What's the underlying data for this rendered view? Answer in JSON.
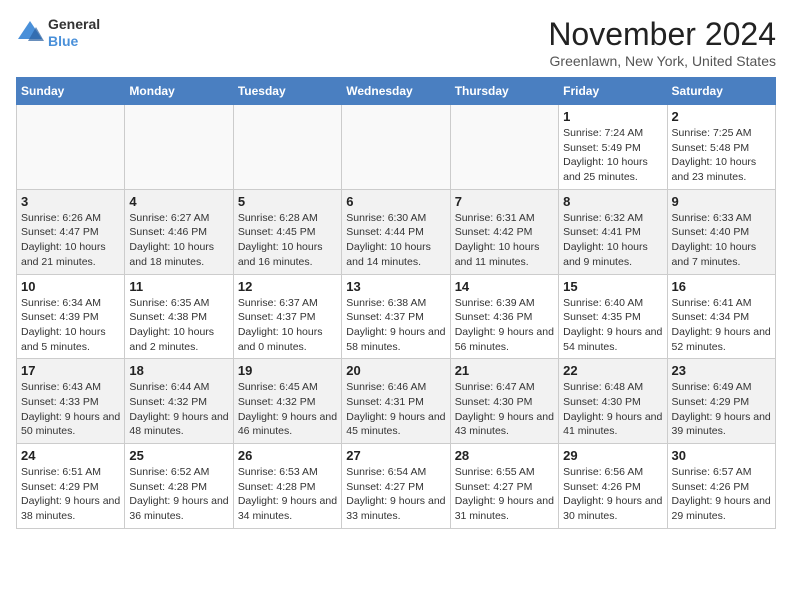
{
  "logo": {
    "general": "General",
    "blue": "Blue"
  },
  "header": {
    "month": "November 2024",
    "location": "Greenlawn, New York, United States"
  },
  "days_of_week": [
    "Sunday",
    "Monday",
    "Tuesday",
    "Wednesday",
    "Thursday",
    "Friday",
    "Saturday"
  ],
  "weeks": [
    {
      "alt": false,
      "days": [
        {
          "num": "",
          "info": ""
        },
        {
          "num": "",
          "info": ""
        },
        {
          "num": "",
          "info": ""
        },
        {
          "num": "",
          "info": ""
        },
        {
          "num": "",
          "info": ""
        },
        {
          "num": "1",
          "info": "Sunrise: 7:24 AM\nSunset: 5:49 PM\nDaylight: 10 hours and 25 minutes."
        },
        {
          "num": "2",
          "info": "Sunrise: 7:25 AM\nSunset: 5:48 PM\nDaylight: 10 hours and 23 minutes."
        }
      ]
    },
    {
      "alt": true,
      "days": [
        {
          "num": "3",
          "info": "Sunrise: 6:26 AM\nSunset: 4:47 PM\nDaylight: 10 hours and 21 minutes."
        },
        {
          "num": "4",
          "info": "Sunrise: 6:27 AM\nSunset: 4:46 PM\nDaylight: 10 hours and 18 minutes."
        },
        {
          "num": "5",
          "info": "Sunrise: 6:28 AM\nSunset: 4:45 PM\nDaylight: 10 hours and 16 minutes."
        },
        {
          "num": "6",
          "info": "Sunrise: 6:30 AM\nSunset: 4:44 PM\nDaylight: 10 hours and 14 minutes."
        },
        {
          "num": "7",
          "info": "Sunrise: 6:31 AM\nSunset: 4:42 PM\nDaylight: 10 hours and 11 minutes."
        },
        {
          "num": "8",
          "info": "Sunrise: 6:32 AM\nSunset: 4:41 PM\nDaylight: 10 hours and 9 minutes."
        },
        {
          "num": "9",
          "info": "Sunrise: 6:33 AM\nSunset: 4:40 PM\nDaylight: 10 hours and 7 minutes."
        }
      ]
    },
    {
      "alt": false,
      "days": [
        {
          "num": "10",
          "info": "Sunrise: 6:34 AM\nSunset: 4:39 PM\nDaylight: 10 hours and 5 minutes."
        },
        {
          "num": "11",
          "info": "Sunrise: 6:35 AM\nSunset: 4:38 PM\nDaylight: 10 hours and 2 minutes."
        },
        {
          "num": "12",
          "info": "Sunrise: 6:37 AM\nSunset: 4:37 PM\nDaylight: 10 hours and 0 minutes."
        },
        {
          "num": "13",
          "info": "Sunrise: 6:38 AM\nSunset: 4:37 PM\nDaylight: 9 hours and 58 minutes."
        },
        {
          "num": "14",
          "info": "Sunrise: 6:39 AM\nSunset: 4:36 PM\nDaylight: 9 hours and 56 minutes."
        },
        {
          "num": "15",
          "info": "Sunrise: 6:40 AM\nSunset: 4:35 PM\nDaylight: 9 hours and 54 minutes."
        },
        {
          "num": "16",
          "info": "Sunrise: 6:41 AM\nSunset: 4:34 PM\nDaylight: 9 hours and 52 minutes."
        }
      ]
    },
    {
      "alt": true,
      "days": [
        {
          "num": "17",
          "info": "Sunrise: 6:43 AM\nSunset: 4:33 PM\nDaylight: 9 hours and 50 minutes."
        },
        {
          "num": "18",
          "info": "Sunrise: 6:44 AM\nSunset: 4:32 PM\nDaylight: 9 hours and 48 minutes."
        },
        {
          "num": "19",
          "info": "Sunrise: 6:45 AM\nSunset: 4:32 PM\nDaylight: 9 hours and 46 minutes."
        },
        {
          "num": "20",
          "info": "Sunrise: 6:46 AM\nSunset: 4:31 PM\nDaylight: 9 hours and 45 minutes."
        },
        {
          "num": "21",
          "info": "Sunrise: 6:47 AM\nSunset: 4:30 PM\nDaylight: 9 hours and 43 minutes."
        },
        {
          "num": "22",
          "info": "Sunrise: 6:48 AM\nSunset: 4:30 PM\nDaylight: 9 hours and 41 minutes."
        },
        {
          "num": "23",
          "info": "Sunrise: 6:49 AM\nSunset: 4:29 PM\nDaylight: 9 hours and 39 minutes."
        }
      ]
    },
    {
      "alt": false,
      "days": [
        {
          "num": "24",
          "info": "Sunrise: 6:51 AM\nSunset: 4:29 PM\nDaylight: 9 hours and 38 minutes."
        },
        {
          "num": "25",
          "info": "Sunrise: 6:52 AM\nSunset: 4:28 PM\nDaylight: 9 hours and 36 minutes."
        },
        {
          "num": "26",
          "info": "Sunrise: 6:53 AM\nSunset: 4:28 PM\nDaylight: 9 hours and 34 minutes."
        },
        {
          "num": "27",
          "info": "Sunrise: 6:54 AM\nSunset: 4:27 PM\nDaylight: 9 hours and 33 minutes."
        },
        {
          "num": "28",
          "info": "Sunrise: 6:55 AM\nSunset: 4:27 PM\nDaylight: 9 hours and 31 minutes."
        },
        {
          "num": "29",
          "info": "Sunrise: 6:56 AM\nSunset: 4:26 PM\nDaylight: 9 hours and 30 minutes."
        },
        {
          "num": "30",
          "info": "Sunrise: 6:57 AM\nSunset: 4:26 PM\nDaylight: 9 hours and 29 minutes."
        }
      ]
    }
  ]
}
